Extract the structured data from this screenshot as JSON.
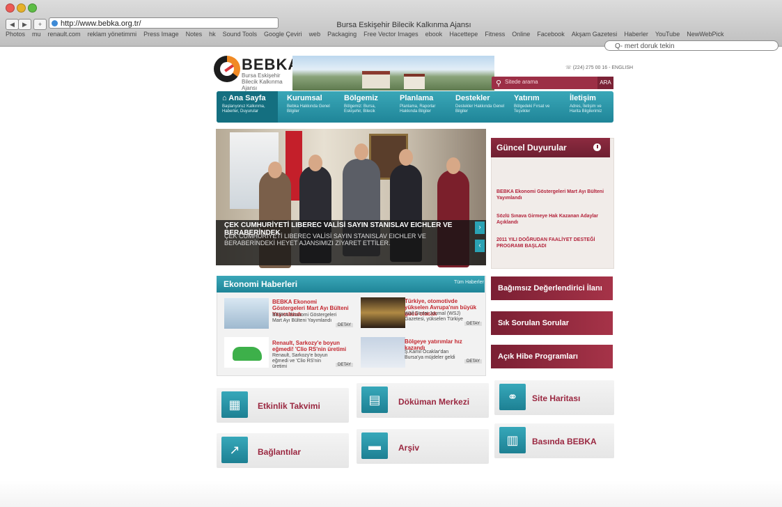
{
  "browser": {
    "title": "Bursa Eskişehir Bilecik Kalkınma Ajansı",
    "url": "http://www.bebka.org.tr/",
    "search_placeholder": "Q- mert doruk tekin",
    "bookmarks": [
      "Photos",
      "mu",
      "renault.com",
      "reklam yönetimmi",
      "Press Image",
      "Notes",
      "hk",
      "Sound Tools",
      "Google Çeviri",
      "web",
      "Packaging",
      "Free Vector Images",
      "ebook",
      "Hacettepe",
      "Fitness",
      "Online",
      "Facebook",
      "Akşam Gazetesi",
      "Haberler",
      "YouTube",
      "NewWebPick"
    ]
  },
  "header": {
    "logo_text": "BEBKA",
    "logo_sub": "Bursa Eskişehir Bilecik Kalkınma Ajansı",
    "top_info": "☏ (224) 275 00 16 - ENGLISH",
    "search_placeholder": "Sitede arama",
    "search_button": "ARA"
  },
  "nav": [
    {
      "title": "Ana Sayfa",
      "sub": "Başlarıyoruz Kalkınma, Haberler, Duyurular"
    },
    {
      "title": "Kurumsal",
      "sub": "Bebka Hakkında Genel Bilgiler"
    },
    {
      "title": "Bölgemiz",
      "sub": "Bölgemiz: Bursa, Eskişehir, Bilecik"
    },
    {
      "title": "Planlama",
      "sub": "Planlama, Raporlar Hakkında Bilgiler"
    },
    {
      "title": "Destekler",
      "sub": "Destekler Hakkında Genel Bilgiler"
    },
    {
      "title": "Yatırım",
      "sub": "Bölgedeki Fırsat ve Teşvikler"
    },
    {
      "title": "İletişim",
      "sub": "Adres, İletişim ve Harita Bilgilerimiz"
    }
  ],
  "slider": {
    "title": "ÇEK CUMHURİYETİ LIBEREC VALİSİ SAYIN STANISLAV EICHLER VE BERABERİNDEK",
    "text": "ÇEK CUMHURİYETİ LIBEREC VALİSİ SAYIN STANISLAV EICHLER VE BERABERİNDEKİ HEYET AJANSIMIZI ZİYARET ETTİLER."
  },
  "announcements": {
    "title": "Güncel Duyurular",
    "items": [
      "BEBKA Ekonomi Göstergeleri Mart Ayı Bülteni Yayımlandı",
      "Sözlü Sınava Girmeye Hak Kazanan Adaylar Açıklandı",
      "2011 YILI DOĞRUDAN FAALİYET DESTEĞİ PROGRAMI BAŞLADI"
    ]
  },
  "economy": {
    "title": "Ekonomi Haberleri",
    "all_link": "Tüm Haberler",
    "more_label": "DETAY",
    "news": [
      {
        "title": "BEBKA Ekonomi Göstergeleri Mart Ayı Bülteni Yayımlandı",
        "text": "BEBKA Ekonomi Göstergeleri Mart Ayı Bülteni Yayımlandı"
      },
      {
        "title": "Türkiye, otomotivde yükselen Avrupa'nın büyük gücü olacak",
        "text": "Wall Street Journal (WSJ) Gazetesi, yükselen Türkiye"
      },
      {
        "title": "Renault, Sarkozy'e boyun eğmedi! 'Clio RS'nin üretimi",
        "text": "Renault, Sarkozy'e boyun eğmedi ve 'Clio RS'nin üretimi"
      },
      {
        "title": "Bölgeye yatırımlar hız kazandı",
        "text": "Ş.Kamil Ocaklar'dan Bursa'ya müjdeler geldi"
      }
    ]
  },
  "banners": [
    "Bağımsız Değerlendirici İlanı",
    "Sık Sorulan Sorular",
    "Açık Hibe Programları"
  ],
  "tiles": [
    {
      "label": "Etkinlik Takvimi",
      "icon": "calendar-icon"
    },
    {
      "label": "Döküman Merkezi",
      "icon": "document-icon"
    },
    {
      "label": "Site Haritası",
      "icon": "link-icon"
    },
    {
      "label": "Bağlantılar",
      "icon": "external-link-icon"
    },
    {
      "label": "Arşiv",
      "icon": "folder-icon"
    },
    {
      "label": "Basında BEBKA",
      "icon": "newspaper-icon"
    }
  ],
  "colors": {
    "teal": "#2595a8",
    "maroon": "#8d2b40",
    "accent_red": "#c3262e"
  }
}
